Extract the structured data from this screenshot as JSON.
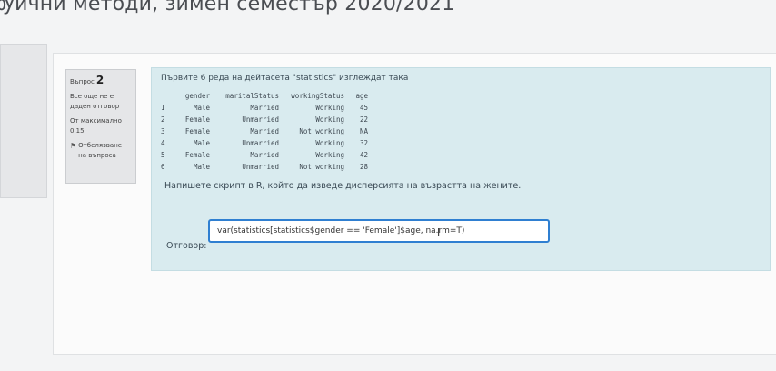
{
  "page": {
    "course_title": "ѹични методи, зимен семестър 2020/2021"
  },
  "question_info": {
    "label": "Въпрос",
    "number": "2",
    "status": "Все още не е даден отговор",
    "max_points": "От максимално 0,15",
    "flag_label": "Отбелязване на въпроса"
  },
  "question": {
    "intro": "Първите 6 реда на дейтасета \"statistics\" изглеждат така",
    "table": {
      "headers": [
        "gender",
        "maritalStatus",
        "workingStatus",
        "age"
      ],
      "rows": [
        {
          "n": "1",
          "gender": "Male",
          "marital": "Married",
          "work": "Working",
          "age": "45"
        },
        {
          "n": "2",
          "gender": "Female",
          "marital": "Unmarried",
          "work": "Working",
          "age": "22"
        },
        {
          "n": "3",
          "gender": "Female",
          "marital": "Married",
          "work": "Not working",
          "age": "NA"
        },
        {
          "n": "4",
          "gender": "Male",
          "marital": "Unmarried",
          "work": "Working",
          "age": "32"
        },
        {
          "n": "5",
          "gender": "Female",
          "marital": "Married",
          "work": "Working",
          "age": "42"
        },
        {
          "n": "6",
          "gender": "Male",
          "marital": "Unmarried",
          "work": "Not working",
          "age": "28"
        }
      ]
    },
    "prompt": "Напишете скрипт в R, който да изведе дисперсията на възрастта на жените.",
    "answer_label": "Отговор:",
    "answer_value": "var(statistics[statistics$gender == 'Female']$age, na.rm=T)"
  }
}
